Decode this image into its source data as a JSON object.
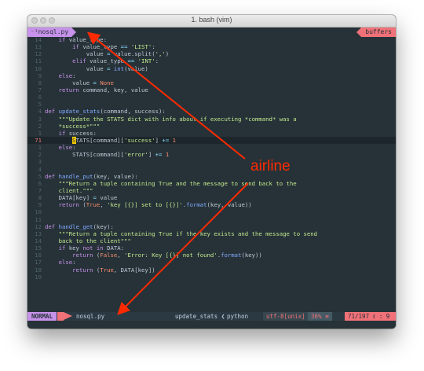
{
  "window": {
    "title": "1. bash (vim)"
  },
  "tabline": {
    "file": "⁻¹nosql.py",
    "buffers": "buffers"
  },
  "status": {
    "mode": "NORMAL",
    "file": "nosql.py",
    "function": "update_stats",
    "filetype": "python",
    "encoding": "utf-8[unix]",
    "percent": "36%",
    "position": "71/197",
    "column": "9"
  },
  "annotation": {
    "label": "airline",
    "color": "#ff2a00"
  },
  "colors": {
    "background": "#263238",
    "keyword": "#c792ea",
    "function": "#82aaff",
    "string": "#c3e88d",
    "constant": "#f78c6c",
    "accent": "#f07178"
  },
  "code_lines": [
    {
      "n": "14",
      "segs": [
        [
          "pl",
          "    "
        ],
        [
          "kw",
          "if"
        ],
        [
          "pl",
          " value_type:"
        ]
      ]
    },
    {
      "n": "13",
      "segs": [
        [
          "pl",
          "        "
        ],
        [
          "kw",
          "if"
        ],
        [
          "pl",
          " value_type "
        ],
        [
          "op",
          "=="
        ],
        [
          "pl",
          " "
        ],
        [
          "st",
          "'LIST'"
        ],
        [
          "pl",
          ":"
        ]
      ]
    },
    {
      "n": "12",
      "segs": [
        [
          "pl",
          "            value "
        ],
        [
          "op",
          "="
        ],
        [
          "pl",
          " value.split("
        ],
        [
          "st",
          "','"
        ],
        [
          "pl",
          ")"
        ]
      ]
    },
    {
      "n": "11",
      "segs": [
        [
          "pl",
          "        "
        ],
        [
          "kw",
          "elif"
        ],
        [
          "pl",
          " value_type "
        ],
        [
          "op",
          "=="
        ],
        [
          "pl",
          " "
        ],
        [
          "st",
          "'INT'"
        ],
        [
          "pl",
          ":"
        ]
      ]
    },
    {
      "n": "10",
      "segs": [
        [
          "pl",
          "            value "
        ],
        [
          "op",
          "="
        ],
        [
          "pl",
          " "
        ],
        [
          "fn",
          "int"
        ],
        [
          "pl",
          "(value)"
        ]
      ]
    },
    {
      "n": "9",
      "segs": [
        [
          "pl",
          "    "
        ],
        [
          "kw",
          "else"
        ],
        [
          "pl",
          ":"
        ]
      ]
    },
    {
      "n": "8",
      "segs": [
        [
          "pl",
          "        value "
        ],
        [
          "op",
          "="
        ],
        [
          "pl",
          " "
        ],
        [
          "co",
          "None"
        ]
      ]
    },
    {
      "n": "7",
      "segs": [
        [
          "pl",
          "    "
        ],
        [
          "kw",
          "return"
        ],
        [
          "pl",
          " command, key, value"
        ]
      ]
    },
    {
      "n": "6",
      "segs": []
    },
    {
      "n": "5",
      "segs": []
    },
    {
      "n": "4",
      "segs": [
        [
          "kw",
          "def"
        ],
        [
          "pl",
          " "
        ],
        [
          "fn",
          "update_stats"
        ],
        [
          "pl",
          "(command, success):"
        ]
      ]
    },
    {
      "n": "3",
      "segs": [
        [
          "pl",
          "    "
        ],
        [
          "st",
          "\"\"\"Update the STATS dict with info about if executing *command* was a"
        ]
      ]
    },
    {
      "n": "2",
      "segs": [
        [
          "pl",
          "    "
        ],
        [
          "st",
          "*success*\"\"\""
        ]
      ]
    },
    {
      "n": "1",
      "segs": [
        [
          "pl",
          "    "
        ],
        [
          "kw",
          "if"
        ],
        [
          "pl",
          " success:"
        ]
      ]
    },
    {
      "n": "71",
      "cur": true,
      "segs": [
        [
          "pl",
          "        "
        ],
        [
          "cursor",
          "S"
        ],
        [
          "pl",
          "TATS[command]["
        ],
        [
          "st",
          "'success'"
        ],
        [
          "pl",
          "] "
        ],
        [
          "op",
          "+="
        ],
        [
          "pl",
          " "
        ],
        [
          "co",
          "1"
        ]
      ]
    },
    {
      "n": "1",
      "segs": [
        [
          "pl",
          "    "
        ],
        [
          "kw",
          "else"
        ],
        [
          "pl",
          ":"
        ]
      ]
    },
    {
      "n": "2",
      "segs": [
        [
          "pl",
          "        STATS[command]["
        ],
        [
          "st",
          "'error'"
        ],
        [
          "pl",
          "] "
        ],
        [
          "op",
          "+="
        ],
        [
          "pl",
          " "
        ],
        [
          "co",
          "1"
        ]
      ]
    },
    {
      "n": "3",
      "segs": []
    },
    {
      "n": "4",
      "segs": []
    },
    {
      "n": "5",
      "segs": [
        [
          "kw",
          "def"
        ],
        [
          "pl",
          " "
        ],
        [
          "fn",
          "handle_put"
        ],
        [
          "pl",
          "(key, value):"
        ]
      ]
    },
    {
      "n": "6",
      "segs": [
        [
          "pl",
          "    "
        ],
        [
          "st",
          "\"\"\"Return a tuple containing True and the message to send back to the"
        ]
      ]
    },
    {
      "n": "7",
      "segs": [
        [
          "pl",
          "    "
        ],
        [
          "st",
          "client.\"\"\""
        ]
      ]
    },
    {
      "n": "8",
      "segs": [
        [
          "pl",
          "    DATA[key] "
        ],
        [
          "op",
          "="
        ],
        [
          "pl",
          " value"
        ]
      ]
    },
    {
      "n": "9",
      "segs": [
        [
          "pl",
          "    "
        ],
        [
          "kw",
          "return"
        ],
        [
          "pl",
          " ("
        ],
        [
          "co",
          "True"
        ],
        [
          "pl",
          ", "
        ],
        [
          "st",
          "'key [{}] set to [{}]'"
        ],
        [
          "pl",
          "."
        ],
        [
          "fn",
          "format"
        ],
        [
          "pl",
          "(key, value))"
        ]
      ]
    },
    {
      "n": "10",
      "segs": []
    },
    {
      "n": "11",
      "segs": []
    },
    {
      "n": "12",
      "segs": [
        [
          "kw",
          "def"
        ],
        [
          "pl",
          " "
        ],
        [
          "fn",
          "handle_get"
        ],
        [
          "pl",
          "(key):"
        ]
      ]
    },
    {
      "n": "13",
      "segs": [
        [
          "pl",
          "    "
        ],
        [
          "st",
          "\"\"\"Return a tuple containing True if the key exists and the message to send"
        ]
      ]
    },
    {
      "n": "14",
      "segs": [
        [
          "pl",
          "    "
        ],
        [
          "st",
          "back to the client\"\"\""
        ]
      ]
    },
    {
      "n": "15",
      "segs": [
        [
          "pl",
          "    "
        ],
        [
          "kw",
          "if"
        ],
        [
          "pl",
          " key "
        ],
        [
          "kw",
          "not in"
        ],
        [
          "pl",
          " DATA:"
        ]
      ]
    },
    {
      "n": "16",
      "segs": [
        [
          "pl",
          "        "
        ],
        [
          "kw",
          "return"
        ],
        [
          "pl",
          " ("
        ],
        [
          "co",
          "False"
        ],
        [
          "pl",
          ", "
        ],
        [
          "st",
          "'Error: Key [{}] not found'"
        ],
        [
          "pl",
          "."
        ],
        [
          "fn",
          "format"
        ],
        [
          "pl",
          "(key))"
        ]
      ]
    },
    {
      "n": "17",
      "segs": [
        [
          "pl",
          "    "
        ],
        [
          "kw",
          "else"
        ],
        [
          "pl",
          ":"
        ]
      ]
    },
    {
      "n": "18",
      "segs": [
        [
          "pl",
          "        "
        ],
        [
          "kw",
          "return"
        ],
        [
          "pl",
          " ("
        ],
        [
          "co",
          "True"
        ],
        [
          "pl",
          ", DATA[key])"
        ]
      ]
    },
    {
      "n": "19",
      "segs": []
    }
  ]
}
